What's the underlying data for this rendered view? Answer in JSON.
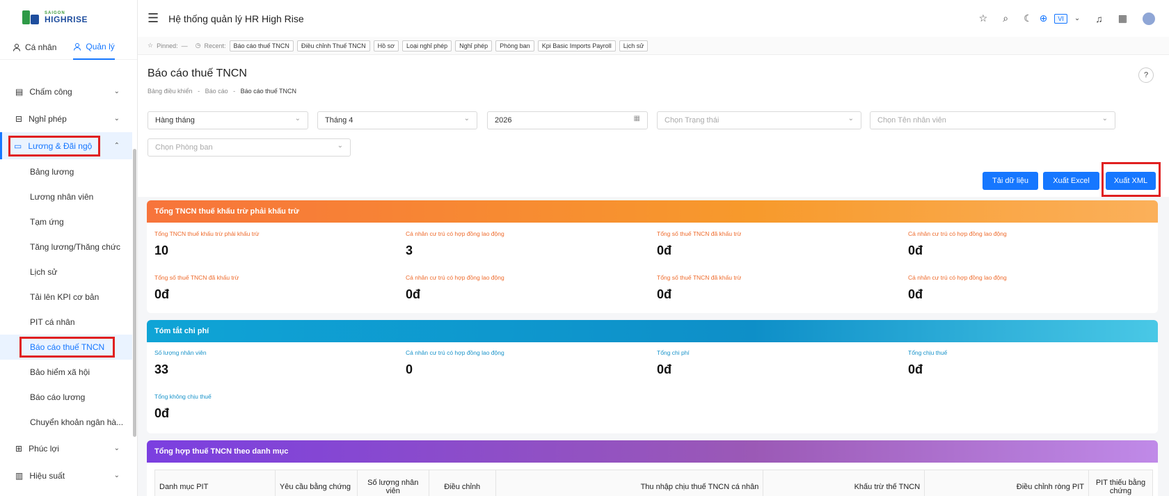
{
  "brand": {
    "line1": "SAIGON",
    "line2": "HIGHRISE"
  },
  "app_title": "Hệ thống quản lý HR High Rise",
  "top_icons": [
    "star-icon",
    "search-icon",
    "moon-icon",
    "plus-circle-icon",
    "bell-icon",
    "calendar-icon"
  ],
  "language": "VI",
  "role_tabs": [
    {
      "label": "Cá nhân",
      "active": false
    },
    {
      "label": "Quản lý",
      "active": true
    }
  ],
  "nav": {
    "attendance": "Chấm công",
    "leave": "Nghỉ phép",
    "payroll": "Lương & Đãi ngộ",
    "payroll_items": [
      "Bảng lương",
      "Lương nhân viên",
      "Tạm ứng",
      "Tăng lương/Thăng chức",
      "Lịch sử",
      "Tải lên KPI cơ bản",
      "PIT cá nhân",
      "Báo cáo thuế TNCN",
      "Bảo hiểm xã hội",
      "Báo cáo lương",
      "Chuyển khoản ngân hà..."
    ],
    "benefits": "Phúc lợi",
    "performance": "Hiệu suất"
  },
  "pinbar": {
    "pinned_label": "Pinned:",
    "pinned_value": "—",
    "recent_label": "Recent:",
    "recent": [
      "Báo cáo thuế TNCN",
      "Điều chỉnh Thuế TNCN",
      "Hồ sơ",
      "Loại nghỉ phép",
      "Nghỉ phép",
      "Phòng ban",
      "Kpi Basic Imports Payroll",
      "Lịch sử"
    ]
  },
  "page": {
    "title": "Báo cáo thuế TNCN",
    "breadcrumb": [
      "Bảng điều khiển",
      "Báo cáo",
      "Báo cáo thuế TNCN"
    ],
    "breadcrumb_sep": "-",
    "help_glyph": "?"
  },
  "filters": {
    "period": "Hàng tháng",
    "month": "Tháng 4",
    "year": "2026",
    "status_placeholder": "Chọn Trạng thái",
    "employee_placeholder": "Chọn Tên nhân viên",
    "department_placeholder": "Chọn Phòng ban"
  },
  "buttons": {
    "load": "Tải dữ liệu",
    "excel": "Xuất Excel",
    "xml": "Xuất XML"
  },
  "tax_card": {
    "title": "Tổng TNCN thuế khấu trừ phải khấu trừ",
    "stats": [
      {
        "label": "Tổng TNCN thuế khấu trừ phải khấu trừ",
        "value": "10"
      },
      {
        "label": "Cá nhân cư trú có hợp đồng lao động",
        "value": "3"
      },
      {
        "label": "Tổng số thuế TNCN đã khấu trừ",
        "value": "0đ"
      },
      {
        "label": "Cá nhân cư trú có hợp đồng lao động",
        "value": "0đ"
      },
      {
        "label": "Tổng số thuế TNCN đã khấu trừ",
        "value": "0đ"
      },
      {
        "label": "Cá nhân cư trú có hợp đồng lao động",
        "value": "0đ"
      },
      {
        "label": "Tổng số thuế TNCN đã khấu trừ",
        "value": "0đ"
      },
      {
        "label": "Cá nhân cư trú có hợp đồng lao động",
        "value": "0đ"
      }
    ]
  },
  "cost_card": {
    "title": "Tóm tắt chi phí",
    "stats": [
      {
        "label": "Số lượng nhân viên",
        "value": "33"
      },
      {
        "label": "Cá nhân cư trú có hợp đồng lao động",
        "value": "0"
      },
      {
        "label": "Tổng chi phí",
        "value": "0đ"
      },
      {
        "label": "Tổng chịu thuế",
        "value": "0đ"
      },
      {
        "label": "Tổng không chịu thuế",
        "value": "0đ"
      }
    ]
  },
  "category_card": {
    "title": "Tổng hợp thuế TNCN theo danh mục",
    "columns": [
      "Danh mục PIT",
      "Yêu cầu bằng chứng",
      "Số lượng nhân viên",
      "Điều chỉnh",
      "Thu nhập chịu thuế TNCN cá nhân",
      "Khấu trừ thế TNCN",
      "Điều chỉnh ròng PIT",
      "PIT thiếu bằng chứng"
    ]
  }
}
